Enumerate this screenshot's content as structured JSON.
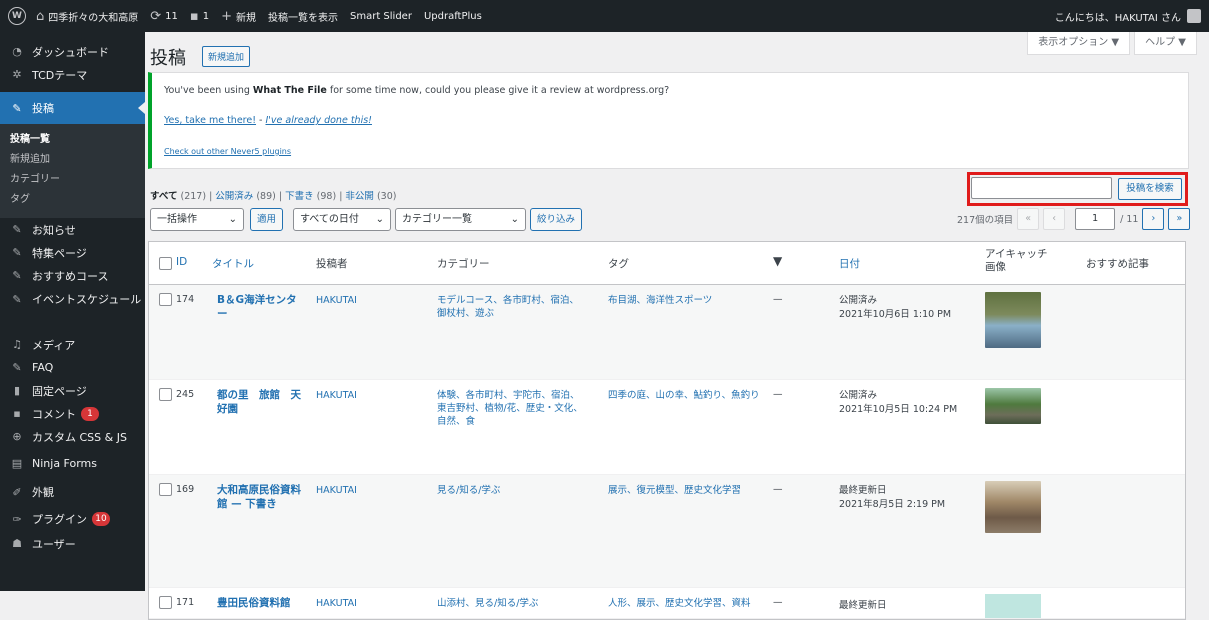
{
  "adminbar": {
    "site_name": "四季折々の大和高原",
    "updates": "11",
    "comments": "1",
    "new_label": "新規",
    "view_posts": "投稿一覧を表示",
    "smart_slider": "Smart Slider",
    "updraft": "UpdraftPlus",
    "greeting": "こんにちは、HAKUTAI さん"
  },
  "sidebar": {
    "items": [
      {
        "label": "ダッシュボード",
        "icon": "dashboard-icon"
      },
      {
        "label": "TCDテーマ",
        "icon": "gear-icon"
      },
      {
        "label": "投稿",
        "icon": "pin-icon"
      },
      {
        "label": "お知らせ",
        "icon": "pin-icon"
      },
      {
        "label": "特集ページ",
        "icon": "pin-icon"
      },
      {
        "label": "おすすめコース",
        "icon": "pin-icon"
      },
      {
        "label": "イベントスケジュール",
        "icon": "pin-icon"
      },
      {
        "label": "メディア",
        "icon": "media-icon"
      },
      {
        "label": "FAQ",
        "icon": "pin-icon"
      },
      {
        "label": "固定ページ",
        "icon": "page-icon"
      },
      {
        "label": "コメント",
        "icon": "comment-icon",
        "badge": "1"
      },
      {
        "label": "カスタム CSS & JS",
        "icon": "plus-circle-icon"
      },
      {
        "label": "Ninja Forms",
        "icon": "forms-icon"
      },
      {
        "label": "外観",
        "icon": "brush-icon"
      },
      {
        "label": "プラグイン",
        "icon": "plugin-icon",
        "badge": "10"
      },
      {
        "label": "ユーザー",
        "icon": "user-icon"
      }
    ],
    "submenu": [
      "投稿一覧",
      "新規追加",
      "カテゴリー",
      "タグ"
    ]
  },
  "header": {
    "title": "投稿",
    "add_new": "新規追加",
    "screen_options": "表示オプション ▼",
    "help": "ヘルプ ▼"
  },
  "notice": {
    "text_before": "You've been using ",
    "plugin": "What The File",
    "text_after": " for some time now, could you please give it a review at wordpress.org?",
    "link_yes": "Yes, take me there!",
    "sep": " - ",
    "link_done": "I've already done this!",
    "link_other": "Check out other Never5 plugins"
  },
  "filters": {
    "all": "すべて",
    "all_count": "(217)",
    "published": "公開済み",
    "published_count": "(89)",
    "draft": "下書き",
    "draft_count": "(98)",
    "private": "非公開",
    "private_count": "(30)",
    "bulk_action": "一括操作",
    "apply": "適用",
    "all_dates": "すべての日付",
    "category_all": "カテゴリー一覧",
    "filter_btn": "絞り込み"
  },
  "search": {
    "value": "",
    "button": "投稿を検索"
  },
  "pagination": {
    "count": "217個の項目",
    "first": "«",
    "prev": "‹",
    "current": "1",
    "total": "/ 11",
    "next": "›",
    "last": "»"
  },
  "table": {
    "headers": {
      "id": "ID",
      "title": "タイトル",
      "author": "投稿者",
      "categories": "カテゴリー",
      "tags": "タグ",
      "date": "日付",
      "featured": "アイキャッチ画像",
      "recommend": "おすすめ記事"
    },
    "rows": [
      {
        "id": "174",
        "title": "B＆G海洋センター",
        "author": "HAKUTAI",
        "categories": "モデルコース、各市町村、宿泊、御杖村、遊ぶ",
        "tags": "布目湖、海洋性スポーツ",
        "comments": "—",
        "status": "公開済み",
        "date": "2021年10月6日 1:10 PM"
      },
      {
        "id": "245",
        "title": "都の里　旅館　天好園",
        "author": "HAKUTAI",
        "categories": "体験、各市町村、宇陀市、宿泊、東吉野村、植物/花、歴史・文化、自然、食",
        "tags": "四季の庭、山の幸、鮎釣り、魚釣り",
        "comments": "—",
        "status": "公開済み",
        "date": "2021年10月5日 10:24 PM"
      },
      {
        "id": "169",
        "title": "大和高原民俗資料館 — 下書き",
        "author": "HAKUTAI",
        "categories": "見る/知る/学ぶ",
        "tags": "展示、復元模型、歴史文化学習",
        "comments": "—",
        "status": "最終更新日",
        "date": "2021年8月5日 2:19 PM"
      },
      {
        "id": "171",
        "title": "豊田民俗資料館",
        "author": "HAKUTAI",
        "categories": "山添村、見る/知る/学ぶ",
        "tags": "人形、展示、歴史文化学習、資料",
        "comments": "—",
        "status": "最終更新日",
        "date": ""
      }
    ]
  }
}
